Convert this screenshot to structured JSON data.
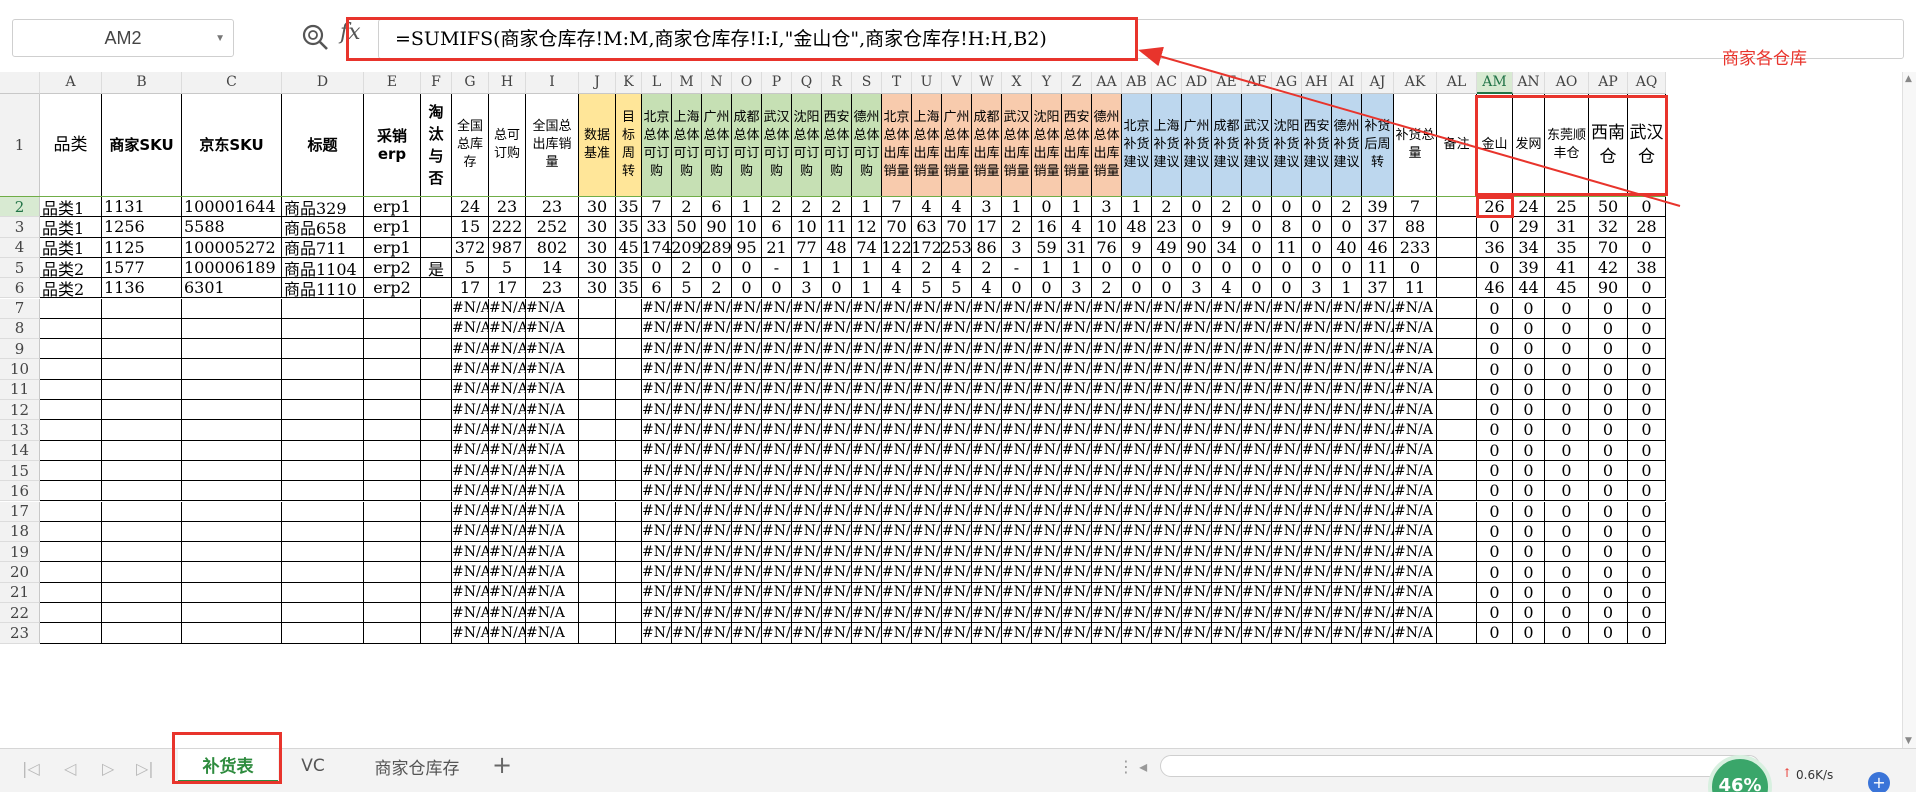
{
  "formula_bar": {
    "name_box": "AM2",
    "fx": "fx",
    "formula": "=SUMIFS(商家仓库存!M:M,商家仓库存!I:I,\"金山仓\",商家仓库存!H:H,B2)"
  },
  "annotation": {
    "label": "商家各仓库",
    "color": "#e8342c"
  },
  "columns": [
    "A",
    "B",
    "C",
    "D",
    "E",
    "F",
    "G",
    "H",
    "I",
    "J",
    "K",
    "L",
    "M",
    "N",
    "O",
    "P",
    "Q",
    "R",
    "S",
    "T",
    "U",
    "V",
    "W",
    "X",
    "Y",
    "Z",
    "AA",
    "AB",
    "AC",
    "AD",
    "AE",
    "AF",
    "AG",
    "AH",
    "AI",
    "AJ",
    "AK",
    "AL",
    "AM",
    "AN",
    "AO",
    "AP",
    "AQ"
  ],
  "selected_column": "AM",
  "selected_row": "2",
  "header_row": [
    "品类",
    "商家SKU",
    "京东SKU",
    "标题",
    "采销erp",
    "淘汰与否",
    "全国总库存",
    "总可订购",
    "全国总出库销量",
    "数据基准",
    "目标周转",
    "北京总体可订购",
    "上海总体可订购",
    "广州总体可订购",
    "成都总体可订购",
    "武汉总体可订购",
    "沈阳总体可订购",
    "西安总体可订购",
    "德州总体可订购",
    "北京总体出库销量",
    "上海总体出库销量",
    "广州总体出库销量",
    "成都总体出库销量",
    "武汉总体出库销量",
    "沈阳总体出库销量",
    "西安总体出库销量",
    "德州总体出库销量",
    "北京补货建议",
    "上海补货建议",
    "广州补货建议",
    "成都补货建议",
    "武汉补货建议",
    "沈阳补货建议",
    "西安补货建议",
    "德州补货建议",
    "补货后周转",
    "补货总量",
    "备注",
    "金山",
    "发网",
    "东莞顺丰仓",
    "西南仓",
    "武汉仓"
  ],
  "data_rows": [
    [
      "品类1",
      "1131",
      "100001644",
      "商品329",
      "erp1",
      "",
      "24",
      "23",
      "23",
      "30",
      "35",
      "7",
      "2",
      "6",
      "1",
      "2",
      "2",
      "2",
      "1",
      "7",
      "4",
      "4",
      "3",
      "1",
      "0",
      "1",
      "3",
      "1",
      "2",
      "0",
      "2",
      "0",
      "0",
      "0",
      "2",
      "39",
      "7",
      "",
      "26",
      "24",
      "25",
      "50",
      "0"
    ],
    [
      "品类1",
      "1256",
      "5588",
      "商品658",
      "erp1",
      "",
      "15",
      "222",
      "252",
      "30",
      "35",
      "33",
      "50",
      "90",
      "10",
      "6",
      "10",
      "11",
      "12",
      "70",
      "63",
      "70",
      "17",
      "2",
      "16",
      "4",
      "10",
      "48",
      "23",
      "0",
      "9",
      "0",
      "8",
      "0",
      "0",
      "37",
      "88",
      "",
      "0",
      "29",
      "31",
      "32",
      "28"
    ],
    [
      "品类1",
      "1125",
      "100005272",
      "商品711",
      "erp1",
      "",
      "372",
      "987",
      "802",
      "30",
      "45",
      "174",
      "209",
      "289",
      "95",
      "21",
      "77",
      "48",
      "74",
      "122",
      "172",
      "253",
      "86",
      "3",
      "59",
      "31",
      "76",
      "9",
      "49",
      "90",
      "34",
      "0",
      "11",
      "0",
      "40",
      "46",
      "233",
      "",
      "36",
      "34",
      "35",
      "70",
      "0"
    ],
    [
      "品类2",
      "1577",
      "100006189",
      "商品1104",
      "erp2",
      "是",
      "5",
      "5",
      "14",
      "30",
      "35",
      "0",
      "2",
      "0",
      "0",
      "-",
      "1",
      "1",
      "1",
      "4",
      "2",
      "4",
      "2",
      "-",
      "1",
      "1",
      "0",
      "0",
      "0",
      "0",
      "0",
      "0",
      "0",
      "0",
      "0",
      "11",
      "0",
      "",
      "0",
      "39",
      "41",
      "42",
      "38"
    ],
    [
      "品类2",
      "1136",
      "6301",
      "商品1110",
      "erp2",
      "",
      "17",
      "17",
      "23",
      "30",
      "35",
      "6",
      "5",
      "2",
      "0",
      "0",
      "3",
      "0",
      "1",
      "4",
      "5",
      "5",
      "4",
      "0",
      "0",
      "3",
      "2",
      "0",
      "0",
      "3",
      "4",
      "0",
      "0",
      "3",
      "1",
      "37",
      "11",
      "",
      "46",
      "44",
      "45",
      "90",
      "0"
    ]
  ],
  "na_text": "#N/A",
  "empty_row_numbers": [
    "7",
    "8",
    "9",
    "10",
    "11",
    "12",
    "13",
    "14",
    "15",
    "16",
    "17",
    "18",
    "19",
    "20",
    "21",
    "22",
    "23"
  ],
  "zero_text": "0",
  "header_colors": {
    "yellow": "#ffe699",
    "green": "#c6e0b4",
    "orange": "#f8cbad",
    "blue": "#bdd7ee"
  },
  "tabs": [
    {
      "label": "补货表",
      "active": true
    },
    {
      "label": "VC",
      "active": false
    },
    {
      "label": "商家仓库存",
      "active": false
    }
  ],
  "add_sheet": "+",
  "status": {
    "percent": "46%",
    "net_speed": "0.6K/s",
    "plus": "+"
  }
}
